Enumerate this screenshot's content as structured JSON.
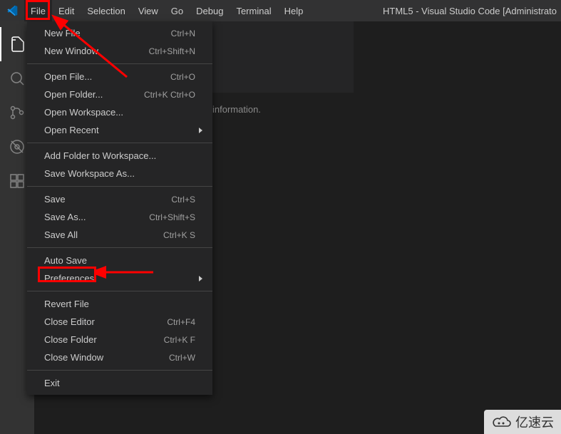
{
  "titlebar": {
    "menu": {
      "file": "File",
      "edit": "Edit",
      "selection": "Selection",
      "view": "View",
      "go": "Go",
      "debug": "Debug",
      "terminal": "Terminal",
      "help": "Help"
    },
    "title": "HTML5 - Visual Studio Code [Administrato"
  },
  "dropdown": {
    "new_file": {
      "label": "New File",
      "shortcut": "Ctrl+N"
    },
    "new_window": {
      "label": "New Window",
      "shortcut": "Ctrl+Shift+N"
    },
    "open_file": {
      "label": "Open File...",
      "shortcut": "Ctrl+O"
    },
    "open_folder": {
      "label": "Open Folder...",
      "shortcut": "Ctrl+K Ctrl+O"
    },
    "open_workspace": {
      "label": "Open Workspace..."
    },
    "open_recent": {
      "label": "Open Recent"
    },
    "add_folder": {
      "label": "Add Folder to Workspace..."
    },
    "save_workspace_as": {
      "label": "Save Workspace As..."
    },
    "save": {
      "label": "Save",
      "shortcut": "Ctrl+S"
    },
    "save_as": {
      "label": "Save As...",
      "shortcut": "Ctrl+Shift+S"
    },
    "save_all": {
      "label": "Save All",
      "shortcut": "Ctrl+K S"
    },
    "auto_save": {
      "label": "Auto Save"
    },
    "preferences": {
      "label": "Preferences"
    },
    "revert_file": {
      "label": "Revert File"
    },
    "close_editor": {
      "label": "Close Editor",
      "shortcut": "Ctrl+F4"
    },
    "close_folder": {
      "label": "Close Folder",
      "shortcut": "Ctrl+K F"
    },
    "close_window": {
      "label": "Close Window",
      "shortcut": "Ctrl+W"
    },
    "exit": {
      "label": "Exit"
    }
  },
  "welcome": {
    "info_fragment": "information."
  },
  "watermark": {
    "text": "亿速云"
  },
  "colors": {
    "accent": "#ff0000",
    "menu_bg": "#252526",
    "titlebar_bg": "#323233",
    "activity_bg": "#333333"
  }
}
